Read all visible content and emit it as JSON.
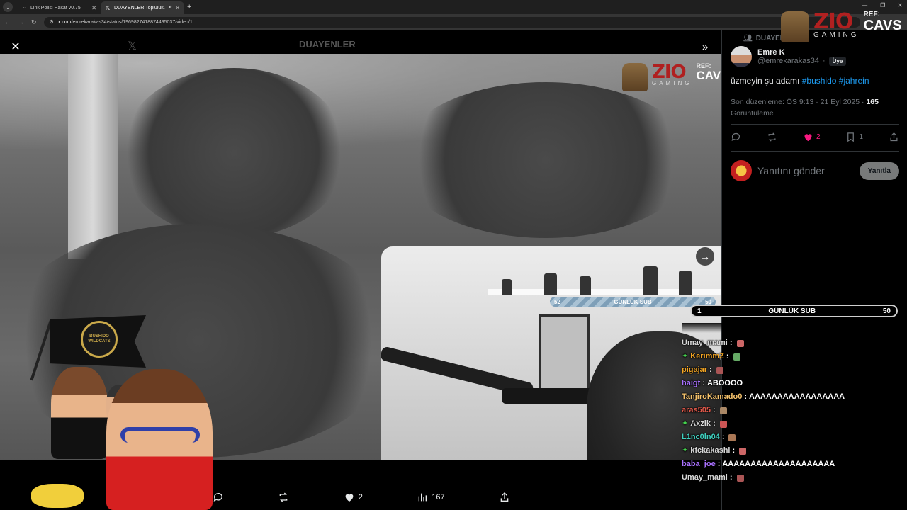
{
  "browser": {
    "tabs": [
      {
        "title": "Link Polisi Hakat v0.75",
        "active": false
      },
      {
        "title": "DUAYENLER Topluluk / X",
        "active": true
      }
    ],
    "url_host": "x.com",
    "url_path": "/emrekarakas34/status/1969827418874495037/video/1"
  },
  "media": {
    "ghost_title": "DUAYENLER",
    "sub_bar_small": {
      "left": "52",
      "label": "GÜNLÜK SUB",
      "right": "50"
    },
    "flag_text": "BUSHIDO WILDCATS",
    "overlay_logo": {
      "brand": "ZIO",
      "sub": "GAMING",
      "ref_label": "REF:",
      "ref_code": "CAVS"
    },
    "actions": {
      "likes": "2",
      "views": "167"
    }
  },
  "sidebar": {
    "community": "DUAYEN",
    "author_name": "Emre K",
    "author_handle": "@emrekarakas34",
    "member_badge": "Üye",
    "tweet_text": "üzmeyin şu adamı",
    "hashtags": [
      "#bushido",
      "#jahrein"
    ],
    "edited_label": "Son düzenleme: ÖS 9:13 · 21 Eyl 2025 · ",
    "views_count": "165",
    "views_label": "Görüntüleme",
    "like_count": "2",
    "bookmark_count": "1",
    "reply_placeholder": "Yanıtını gönder",
    "reply_button": "Yanıtla"
  },
  "stream_overlay": {
    "brand": "ZIO",
    "sub": "GAMING",
    "ref_label": "REF:",
    "ref_code": "CAVS",
    "sub_bar": {
      "left": "1",
      "label": "GÜNLÜK SUB",
      "right": "50"
    },
    "chat": [
      {
        "user": "Umay_mami",
        "color": "#d8d8d8",
        "msg": "",
        "badge": ""
      },
      {
        "user": "KerimmZ",
        "color": "#f5a623",
        "msg": "",
        "badge": "✦"
      },
      {
        "user": "pigajar",
        "color": "#f5a623",
        "msg": "",
        "badge": ""
      },
      {
        "user": "haigt",
        "color": "#a970ff",
        "msg": "ABOOOO",
        "badge": ""
      },
      {
        "user": "TanjiroKamado0",
        "color": "#f5c26b",
        "msg": "AAAAAAAAAAAAAAAAA",
        "badge": ""
      },
      {
        "user": "aras505",
        "color": "#e0584a",
        "msg": "",
        "badge": ""
      },
      {
        "user": "Axzik",
        "color": "#d8d8d8",
        "msg": "",
        "badge": "✦"
      },
      {
        "user": "L1nc0ln04",
        "color": "#3fd1c0",
        "msg": "",
        "badge": ""
      },
      {
        "user": "kfckakashi",
        "color": "#d8d8d8",
        "msg": "",
        "badge": "✦"
      },
      {
        "user": "baba_joe",
        "color": "#a970ff",
        "msg": "AAAAAAAAAAAAAAAAAAAA",
        "badge": ""
      },
      {
        "user": "Umay_mami",
        "color": "#d8d8d8",
        "msg": "",
        "badge": ""
      }
    ]
  },
  "colors": {
    "accent": "#1d9bf0",
    "like": "#f91880",
    "chat_badge": "#45d14e"
  }
}
